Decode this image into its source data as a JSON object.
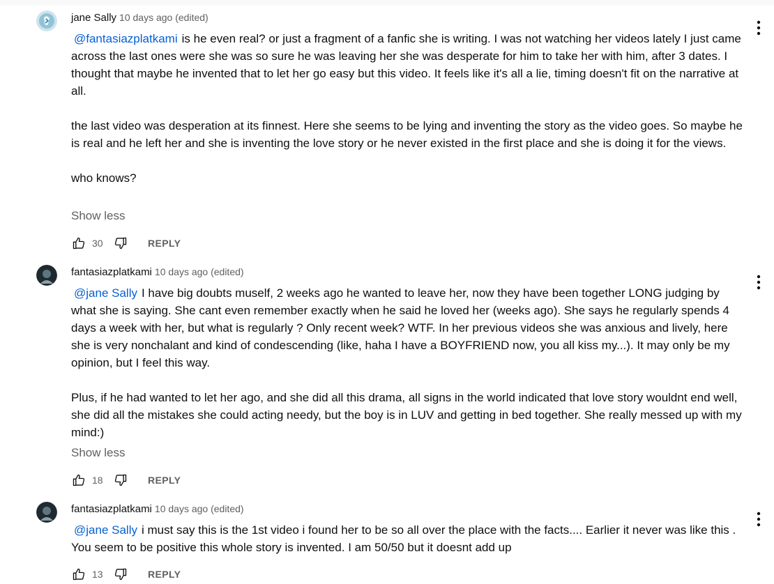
{
  "comments": [
    {
      "author": "jane Sally",
      "meta": "10 days ago (edited)",
      "mention": "@fantasiazplatkami",
      "paragraphs": [
        "is he even real? or just a fragment of a fanfic she is writing. I was not watching her videos lately I just came across the last ones were she was so sure he was leaving her she was desperate for him to take her with him, after 3 dates. I thought that maybe he invented that to let her go easy but this video. It feels like it's all a lie, timing doesn't fit on the narrative at all.",
        "the last video was desperation at its finnest. Here she seems to be lying and inventing the story as the video goes. So maybe he is real and he left her and she is inventing the love story or he never existed in the first place and she is doing it for the views.",
        "who knows?"
      ],
      "show_less": "Show less",
      "likes": "30",
      "reply_label": "REPLY",
      "avatar_color": "#7fb3c8"
    },
    {
      "author": "fantasiazplatkami",
      "meta": "10 days ago (edited)",
      "mention": "@jane Sally",
      "paragraphs": [
        "I have big doubts muself, 2 weeks ago he wanted to leave her, now they have been together LONG judging by what she is saying. She cant even remember exactly when he said he loved her (weeks ago). She says he regularly spends 4 days a week with her, but what is regularly ? Only recent week? WTF. In her previous videos she was anxious and lively, here she is very nonchalant and kind of condescending (like, haha I have a BOYFRIEND now, you all kiss my...). It may only be my opinion, but I feel this way.",
        "Plus, if he had wanted to let her ago, and she did all this drama, all signs in the world indicated that love story wouldnt end well, she did all the mistakes she could acting needy, but the boy is in LUV and getting in bed together. She really messed up with my mind:)"
      ],
      "show_less": "Show less",
      "likes": "18",
      "reply_label": "REPLY",
      "avatar_color": "#2e3b44"
    },
    {
      "author": "fantasiazplatkami",
      "meta": "10 days ago (edited)",
      "mention": "@jane Sally",
      "paragraphs": [
        "i must say this is the 1st video i found her to be so all over the place with the facts.... Earlier it never was like this . You seem to be positive this whole story is invented. I am 50/50 but it doesnt add up"
      ],
      "likes": "13",
      "reply_label": "REPLY",
      "avatar_color": "#2e3b44"
    }
  ],
  "icons": {
    "like": "thumb-up-icon",
    "dislike": "thumb-down-icon",
    "menu": "more-vert-icon"
  }
}
